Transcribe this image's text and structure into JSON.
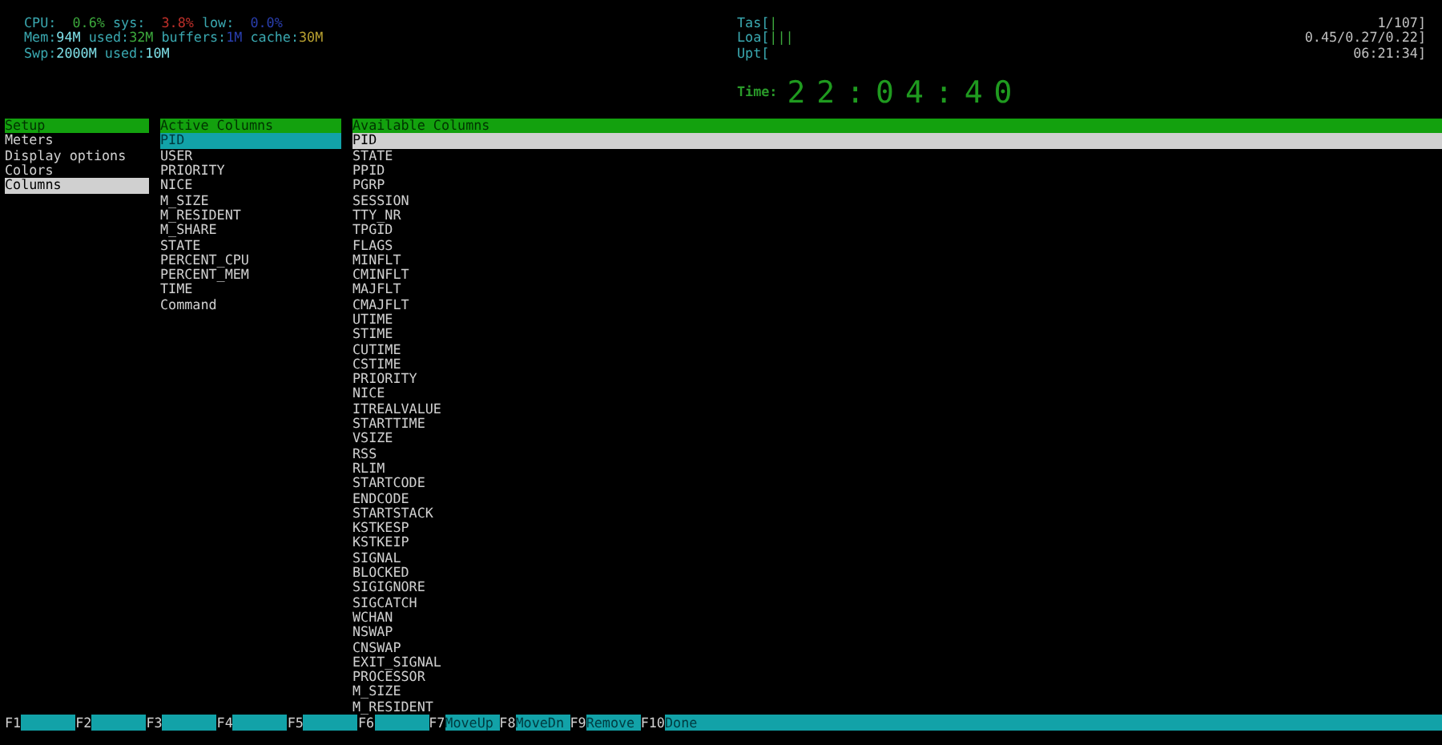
{
  "meters_left": [
    {
      "segments": [
        {
          "text": "CPU:",
          "color": "#3aa8b0"
        },
        {
          "text": "  0.6%",
          "color": "#3ca83c"
        },
        {
          "text": " sys:",
          "color": "#3aa8b0"
        },
        {
          "text": "  3.8%",
          "color": "#c0302a"
        },
        {
          "text": " low:",
          "color": "#3aa8b0"
        },
        {
          "text": "  0.0%",
          "color": "#2a3fb0"
        }
      ]
    },
    {
      "segments": [
        {
          "text": "Mem:",
          "color": "#3aa8b0"
        },
        {
          "text": "94M",
          "color": "#7fe0e8"
        },
        {
          "text": " used:",
          "color": "#3aa8b0"
        },
        {
          "text": "32M",
          "color": "#3ca83c"
        },
        {
          "text": " buffers:",
          "color": "#3aa8b0"
        },
        {
          "text": "1M",
          "color": "#2a3fb0"
        },
        {
          "text": " cache:",
          "color": "#3aa8b0"
        },
        {
          "text": "30M",
          "color": "#b8a030"
        }
      ]
    },
    {
      "segments": [
        {
          "text": "Swp:",
          "color": "#3aa8b0"
        },
        {
          "text": "2000M",
          "color": "#7fe0e8"
        },
        {
          "text": " used:",
          "color": "#3aa8b0"
        },
        {
          "text": "10M",
          "color": "#7fe0e8"
        }
      ]
    }
  ],
  "meters_right": [
    {
      "label": "Tas[",
      "bar": "|",
      "value": "1/107]"
    },
    {
      "label": "Loa[",
      "bar": "|||",
      "value": "0.45/0.27/0.22]"
    },
    {
      "label": "Upt[",
      "value": "06:21:34]"
    }
  ],
  "clock": {
    "label": "Time:",
    "value": "22:04:40"
  },
  "setup_menu": {
    "title": "Setup",
    "items": [
      {
        "label": "Meters",
        "selected": false
      },
      {
        "label": "Display options",
        "selected": false
      },
      {
        "label": "Colors",
        "selected": false
      },
      {
        "label": "Columns",
        "selected": true
      }
    ]
  },
  "active_columns": {
    "title": "Active Columns",
    "items": [
      {
        "label": "PID",
        "selected": true
      },
      {
        "label": "USER",
        "selected": false
      },
      {
        "label": "PRIORITY",
        "selected": false
      },
      {
        "label": "NICE",
        "selected": false
      },
      {
        "label": "M_SIZE",
        "selected": false
      },
      {
        "label": "M_RESIDENT",
        "selected": false
      },
      {
        "label": "M_SHARE",
        "selected": false
      },
      {
        "label": "STATE",
        "selected": false
      },
      {
        "label": "PERCENT_CPU",
        "selected": false
      },
      {
        "label": "PERCENT_MEM",
        "selected": false
      },
      {
        "label": "TIME",
        "selected": false
      },
      {
        "label": "Command",
        "selected": false
      }
    ]
  },
  "available_columns": {
    "title": "Available Columns",
    "items": [
      {
        "label": "PID",
        "selected": true
      },
      {
        "label": "STATE",
        "selected": false
      },
      {
        "label": "PPID",
        "selected": false
      },
      {
        "label": "PGRP",
        "selected": false
      },
      {
        "label": "SESSION",
        "selected": false
      },
      {
        "label": "TTY_NR",
        "selected": false
      },
      {
        "label": "TPGID",
        "selected": false
      },
      {
        "label": "FLAGS",
        "selected": false
      },
      {
        "label": "MINFLT",
        "selected": false
      },
      {
        "label": "CMINFLT",
        "selected": false
      },
      {
        "label": "MAJFLT",
        "selected": false
      },
      {
        "label": "CMAJFLT",
        "selected": false
      },
      {
        "label": "UTIME",
        "selected": false
      },
      {
        "label": "STIME",
        "selected": false
      },
      {
        "label": "CUTIME",
        "selected": false
      },
      {
        "label": "CSTIME",
        "selected": false
      },
      {
        "label": "PRIORITY",
        "selected": false
      },
      {
        "label": "NICE",
        "selected": false
      },
      {
        "label": "ITREALVALUE",
        "selected": false
      },
      {
        "label": "STARTTIME",
        "selected": false
      },
      {
        "label": "VSIZE",
        "selected": false
      },
      {
        "label": "RSS",
        "selected": false
      },
      {
        "label": "RLIM",
        "selected": false
      },
      {
        "label": "STARTCODE",
        "selected": false
      },
      {
        "label": "ENDCODE",
        "selected": false
      },
      {
        "label": "STARTSTACK",
        "selected": false
      },
      {
        "label": "KSTKESP",
        "selected": false
      },
      {
        "label": "KSTKEIP",
        "selected": false
      },
      {
        "label": "SIGNAL",
        "selected": false
      },
      {
        "label": "BLOCKED",
        "selected": false
      },
      {
        "label": "SIGIGNORE",
        "selected": false
      },
      {
        "label": "SIGCATCH",
        "selected": false
      },
      {
        "label": "WCHAN",
        "selected": false
      },
      {
        "label": "NSWAP",
        "selected": false
      },
      {
        "label": "CNSWAP",
        "selected": false
      },
      {
        "label": "EXIT_SIGNAL",
        "selected": false
      },
      {
        "label": "PROCESSOR",
        "selected": false
      },
      {
        "label": "M_SIZE",
        "selected": false
      },
      {
        "label": "M_RESIDENT",
        "selected": false
      }
    ]
  },
  "function_bar": [
    {
      "key": "F1"
    },
    {
      "key": "F2"
    },
    {
      "key": "F3"
    },
    {
      "key": "F4"
    },
    {
      "key": "F5"
    },
    {
      "key": "F6"
    },
    {
      "key": "F7",
      "label": "MoveUp"
    },
    {
      "key": "F8",
      "label": "MoveDn"
    },
    {
      "key": "F9",
      "label": "Remove"
    },
    {
      "key": "F10",
      "label": "Done"
    }
  ]
}
